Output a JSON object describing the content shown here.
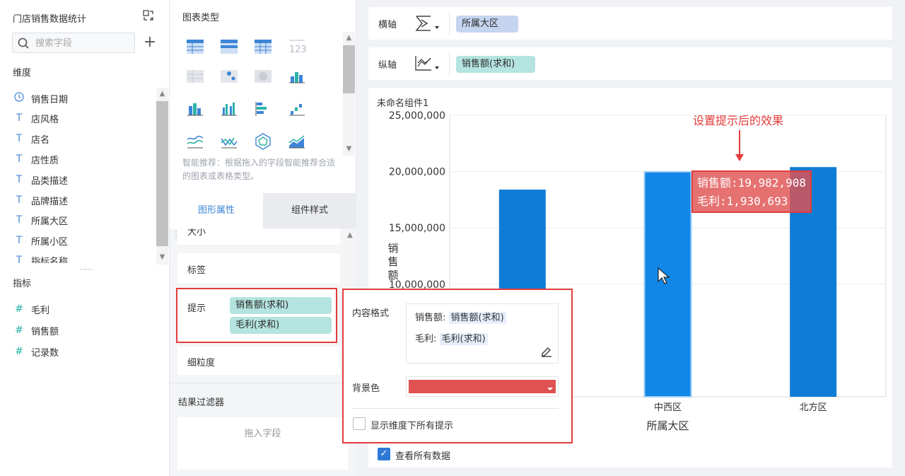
{
  "left_panel": {
    "title": "门店销售数据统计",
    "search_placeholder": "搜索字段",
    "dimensions_label": "维度",
    "dimensions": [
      "销售日期",
      "店风格",
      "店名",
      "店性质",
      "品类描述",
      "品牌描述",
      "所属大区",
      "所属小区",
      "指标名称"
    ],
    "measures_label": "指标",
    "measures": [
      "毛利",
      "销售额",
      "记录数"
    ]
  },
  "middle_panel": {
    "chart_type_title": "图表类型",
    "recommend_text": "智能推荐：根据拖入的字段智能推荐合适的图表或表格类型。",
    "tabs": {
      "active": "图形属性",
      "inactive": "组件样式"
    },
    "size_label": "大小",
    "label_label": "标签",
    "tooltip_label": "提示",
    "tooltip_fields": [
      "销售额(求和)",
      "毛利(求和)"
    ],
    "granularity_label": "细粒度",
    "filter_label": "结果过滤器",
    "filter_placeholder": "拖入字段"
  },
  "axes": {
    "x_label": "横轴",
    "x_field": "所属大区",
    "y_label": "纵轴",
    "y_field": "销售额(求和)"
  },
  "tooltip_popup": {
    "content_format_label": "内容格式",
    "line1_name": "销售额:",
    "line1_field": "销售额(求和)",
    "line2_name": "毛利:",
    "line2_field": "毛利(求和)",
    "bg_color_label": "背景色",
    "bg_color": "#e05252",
    "show_all_label": "显示维度下所有提示"
  },
  "view_all_label": "查看所有数据",
  "colors": {
    "accent": "#3d85d6",
    "bar": "#0f7dd6",
    "highlight": "#e33b3b",
    "pill_green": "#b4e4df",
    "pill_blue": "#c5d5f0"
  },
  "chart_data": {
    "type": "bar",
    "title": "未命名组件1",
    "annotation": "设置提示后的效果",
    "xlabel": "所属大区",
    "ylabel": "销售额",
    "categories": [
      "",
      "中西区",
      "北方区"
    ],
    "values": [
      18400000,
      19982908,
      20400000
    ],
    "ylim": [
      0,
      25000000
    ],
    "y_ticks": [
      "25,000,000",
      "20,000,000",
      "15,000,000",
      "10,000,000"
    ],
    "tooltip": {
      "line1": "销售额:19,982,908",
      "line2": "毛利:1,930,693"
    }
  }
}
